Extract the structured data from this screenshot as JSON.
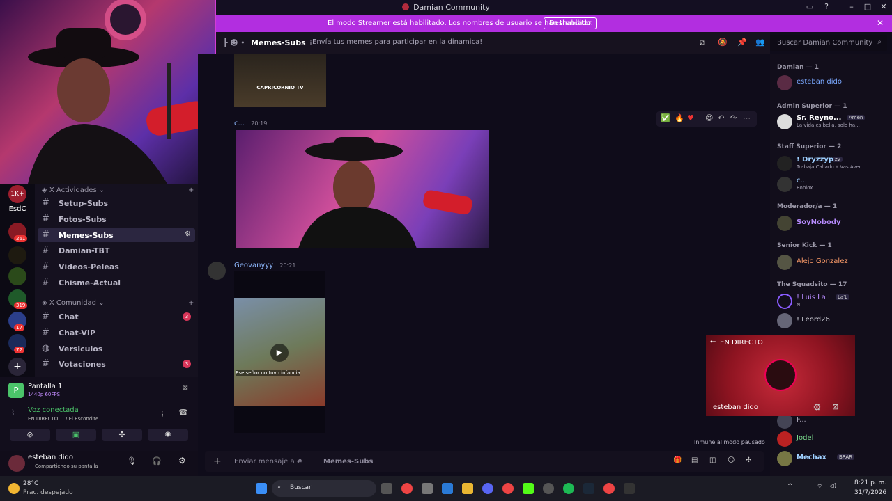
{
  "window": {
    "title": "Damian Community"
  },
  "banner": {
    "message": "El modo Streamer está habilitado. Los nombres de usuario se han truncado.",
    "button": "Deshabilitar"
  },
  "servers": [
    {
      "label": "1K+",
      "badge": ""
    },
    {
      "label": "EsdC",
      "badge": ""
    },
    {
      "label": "",
      "badge": "261"
    },
    {
      "label": "",
      "badge": ""
    },
    {
      "label": "",
      "badge": ""
    },
    {
      "label": "",
      "badge": "319"
    },
    {
      "label": "",
      "badge": "17"
    },
    {
      "label": "",
      "badge": "72"
    }
  ],
  "categories": [
    {
      "label": "X Actividades"
    },
    {
      "label": "X Comunidad"
    }
  ],
  "channels": [
    {
      "name": "Setup-Subs"
    },
    {
      "name": "Fotos-Subs"
    },
    {
      "name": "Memes-Subs"
    },
    {
      "name": "Damian-TBT"
    },
    {
      "name": "Videos-Peleas"
    },
    {
      "name": "Chisme-Actual"
    },
    {
      "name": "Chat",
      "badge": "3"
    },
    {
      "name": "Chat-VIP"
    },
    {
      "name": "Versiculos"
    },
    {
      "name": "Votaciones",
      "badge": "3"
    }
  ],
  "screenshare": {
    "title": "Pantalla 1",
    "quality": "1440p 60FPS"
  },
  "voice": {
    "status": "Voz conectada",
    "location": "EN DIRECTO",
    "channel": "/ El Escondite"
  },
  "user": {
    "name": "esteban dido",
    "status": "Compartiendo su pantalla"
  },
  "header": {
    "channel": "Memes-Subs",
    "topic": "¡Envía tus memes para participar en la dinamica!"
  },
  "search": {
    "placeholder": "Buscar Damian Community"
  },
  "messages": [
    {
      "image_caption": "CAPRICORNIO TV"
    },
    {
      "author": "c...",
      "time": "20:19"
    },
    {
      "author": "Geovanyyy",
      "time": "20:21",
      "image_caption": "Ese señor no tuvo infancia"
    }
  ],
  "composer": {
    "placeholder": "Enviar mensaje a #",
    "channel": "Memes-Subs"
  },
  "paused_note": "Inmune al modo pausado",
  "members": {
    "groups": [
      {
        "label": "Damian — 1"
      },
      {
        "label": "Admin Superior — 1"
      },
      {
        "label": "Staff Superior — 2"
      },
      {
        "label": "Moderador/a — 1"
      },
      {
        "label": "Senior Kick — 1"
      },
      {
        "label": "The Squadsito — 17"
      }
    ],
    "list": [
      {
        "name": "esteban dido",
        "status": "",
        "color": "#7aa8ff"
      },
      {
        "name": "Sr. Reyno...",
        "status": "La vida es bella, solo ha...",
        "tag": "Amén",
        "color": "#ffffff"
      },
      {
        "name": "! Dryzzypr",
        "status": "Trabaja Callado Y Vas Aver ...",
        "tag": "zv",
        "color": "#9fd0ff"
      },
      {
        "name": "c...",
        "status": "Roblox",
        "color": "#9fd0ff"
      },
      {
        "name": "SoyNobody",
        "status": "",
        "color": "#b88cff"
      },
      {
        "name": "Alejo Gonzalez",
        "status": "",
        "color": "#ff9d6a"
      },
      {
        "name": "! Luis La L",
        "status": "N",
        "tag": "La'L",
        "color": "#b88cff"
      },
      {
        "name": "! Leord26",
        "status": "",
        "color": "#d7d7e0"
      },
      {
        "name": "F...",
        "status": "",
        "color": "#a8a4b6"
      },
      {
        "name": "Jodel",
        "status": "",
        "color": "#7bdc8e"
      },
      {
        "name": "Mechax",
        "status": "",
        "tag": "BRAR",
        "color": "#9fd0ff"
      }
    ]
  },
  "popout": {
    "label": "EN DIRECTO",
    "name": "esteban dido"
  },
  "taskbar": {
    "temp": "28°C",
    "weather": "Prac. despejado",
    "search": "Buscar",
    "time": "8:21 p. m.",
    "date": "31/7/2026"
  },
  "colors": {
    "accent": "#b22ee0",
    "bg": "#0f0c1a",
    "live": "#c72a3a"
  }
}
